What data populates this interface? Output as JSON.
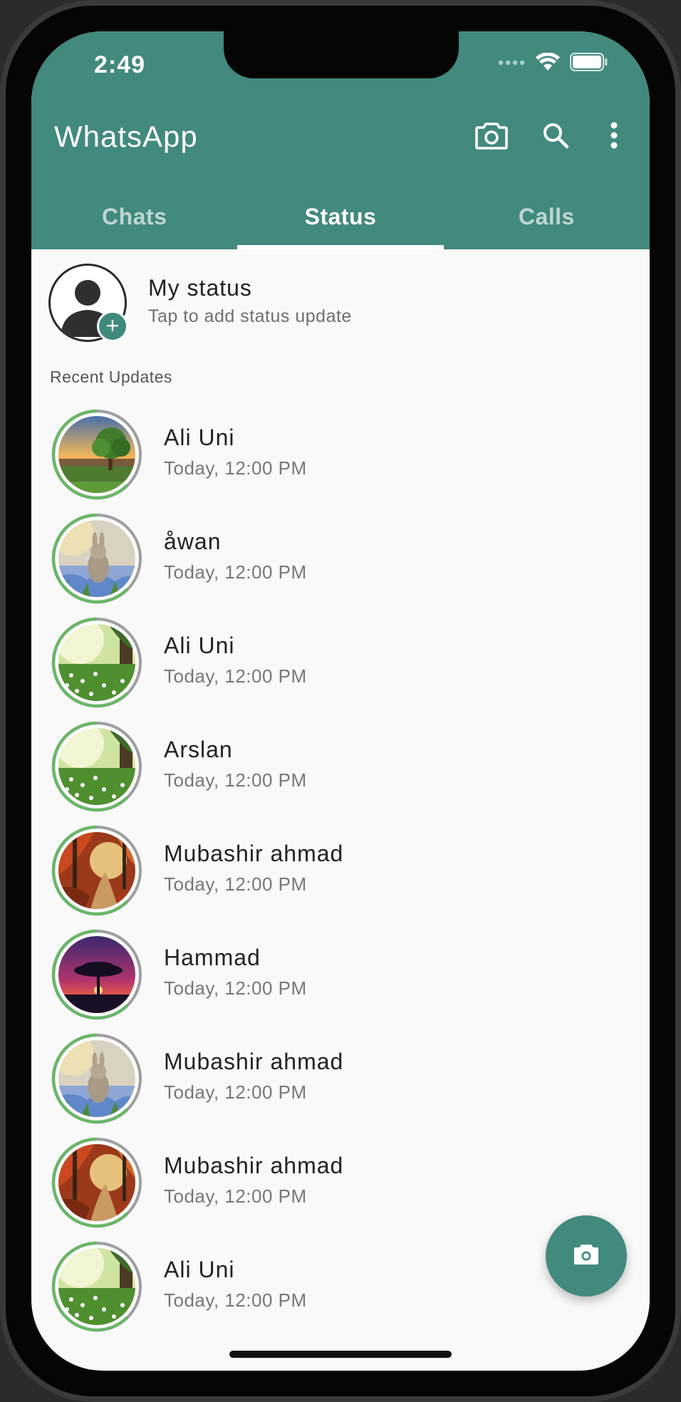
{
  "device": {
    "time": "2:49"
  },
  "app": {
    "title": "WhatsApp"
  },
  "tabs": [
    {
      "label": "Chats",
      "active": false
    },
    {
      "label": "Status",
      "active": true
    },
    {
      "label": "Calls",
      "active": false
    }
  ],
  "my_status": {
    "name": "My status",
    "subtitle": "Tap to add status update"
  },
  "section_label": "Recent Updates",
  "updates": [
    {
      "name": "Ali Uni",
      "time": "Today, 12:00 PM",
      "thumb": "tree-sunset"
    },
    {
      "name": "åwan",
      "time": "Today, 12:00 PM",
      "thumb": "rabbit-flowers"
    },
    {
      "name": "Ali Uni",
      "time": "Today, 12:00 PM",
      "thumb": "green-meadow"
    },
    {
      "name": "Arslan",
      "time": "Today, 12:00 PM",
      "thumb": "green-meadow"
    },
    {
      "name": "Mubashir ahmad",
      "time": "Today, 12:00 PM",
      "thumb": "autumn-path"
    },
    {
      "name": "Hammad",
      "time": "Today, 12:00 PM",
      "thumb": "purple-tree"
    },
    {
      "name": "Mubashir ahmad",
      "time": "Today, 12:00 PM",
      "thumb": "rabbit-flowers"
    },
    {
      "name": "Mubashir ahmad",
      "time": "Today, 12:00 PM",
      "thumb": "autumn-path"
    },
    {
      "name": "Ali Uni",
      "time": "Today, 12:00 PM",
      "thumb": "green-meadow"
    }
  ],
  "colors": {
    "brand": "#42897e",
    "ring_green": "#6bb56a",
    "ring_gray": "#9e9e9e"
  },
  "icons": {
    "camera": "camera-icon",
    "search": "search-icon",
    "more": "more-vert-icon"
  }
}
